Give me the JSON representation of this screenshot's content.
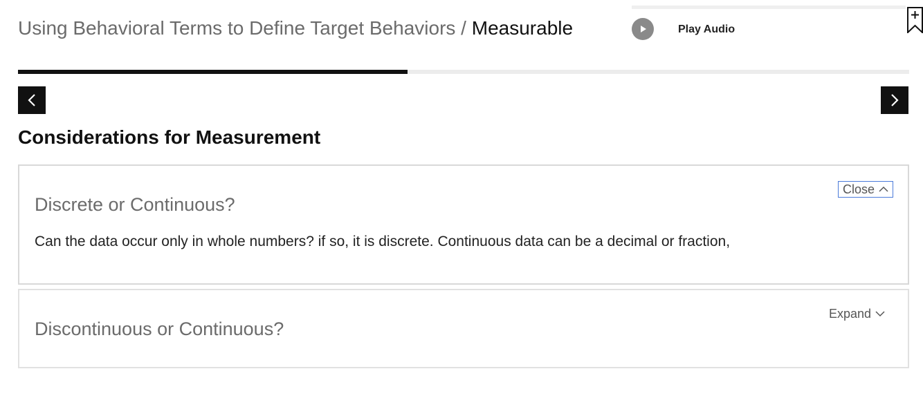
{
  "header": {
    "breadcrumb_parent": "Using Behavioral Terms to Define Target Behaviors",
    "separator": " / ",
    "current": "Measurable"
  },
  "audio": {
    "label": "Play Audio",
    "play_icon": "play-icon"
  },
  "bookmark": {
    "icon": "bookmark-add-icon"
  },
  "progress": {
    "percent": 43.7
  },
  "navigation": {
    "prev_icon": "chevron-left-icon",
    "next_icon": "chevron-right-icon"
  },
  "section": {
    "heading": "Considerations for Measurement"
  },
  "accordions": [
    {
      "title": "Discrete or Continuous?",
      "toggle_label": "Close",
      "toggle_icon": "chevron-up-icon",
      "expanded": true,
      "body": "Can the data occur only in whole numbers?  if so, it is discrete.  Continuous data can be a decimal or fraction,"
    },
    {
      "title": "Discontinuous or Continuous?",
      "toggle_label": "Expand",
      "toggle_icon": "chevron-down-icon",
      "expanded": false
    }
  ]
}
